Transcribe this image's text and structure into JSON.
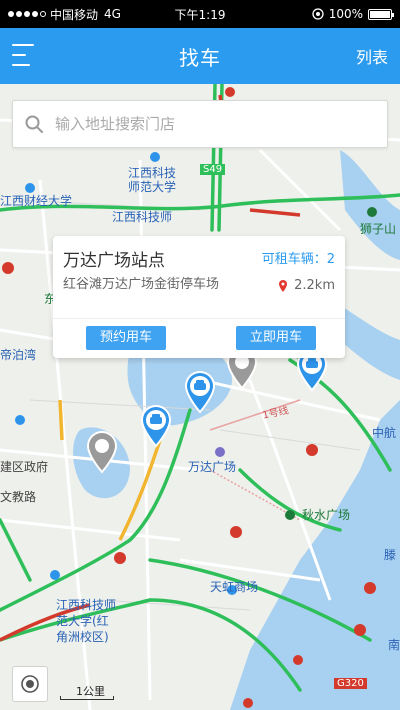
{
  "status_bar": {
    "carrier": "中国移动",
    "network": "4G",
    "time": "下午1:19",
    "battery": "100%"
  },
  "nav": {
    "title": "找车",
    "right_label": "列表",
    "menu_icon": "menu-icon"
  },
  "search": {
    "placeholder": "输入地址搜索门店",
    "value": ""
  },
  "map_labels": {
    "university_1": "江西科技",
    "university_1b": "师范大学",
    "finance_univ": "江西财经大学",
    "sci_univ_2": "江西科技师",
    "road_s49": "S49",
    "lion": "狮子山",
    "dizhiwan": "帝泊湾",
    "jian_district": "建区政府",
    "wenjiao": "文教路",
    "wanda": "万达广场",
    "qiushui": "秋水广场",
    "tianhong": "天虹商场",
    "line1": "1号线",
    "zhonghang": "中航",
    "sci_univ_3a": "江西科技师",
    "sci_univ_3b": "范大学(红",
    "sci_univ_3c": "角洲校区)",
    "g320": "G320",
    "teng": "滕",
    "dong": "东",
    "nan": "南"
  },
  "station_card": {
    "title": "万达广场站点",
    "available_label": "可租车辆：2",
    "address": "红谷滩万达广场金街停车场",
    "distance": "2.2km",
    "reserve_button": "预约用车",
    "use_now_button": "立即用车"
  },
  "scale": {
    "label": "1公里"
  },
  "colors": {
    "primary": "#2a9bef",
    "button": "#3fa3f1",
    "marker_blue": "#2e94ea",
    "marker_gray": "#9a9a9a",
    "road_green": "#2fbf5a",
    "road_yellow": "#f2b530",
    "road_red": "#d33a2c",
    "water": "#a8d0f0"
  }
}
